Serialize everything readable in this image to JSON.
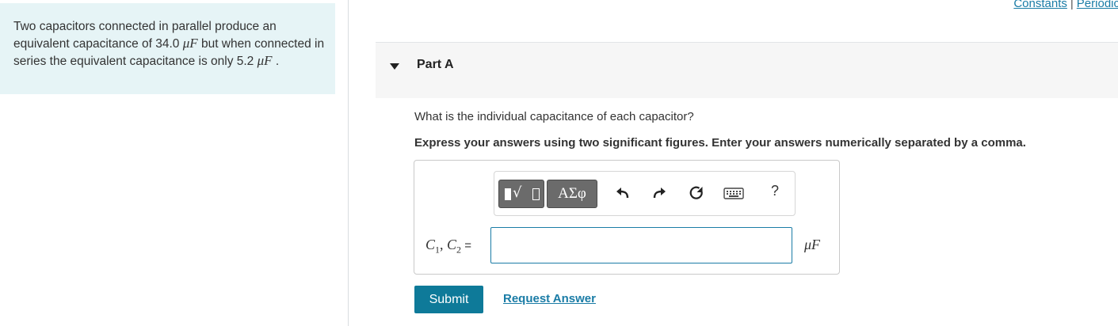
{
  "top_links": {
    "constants": "Constants",
    "separator": "|",
    "periodic": "Periodic"
  },
  "problem": {
    "text_before": "Two capacitors connected in parallel produce an equivalent capacitance of 34.0 ",
    "unit_1": "μF",
    "text_middle": " but when connected in series the equivalent capacitance is only 5.2 ",
    "unit_2": "μF",
    "text_after": " ."
  },
  "part": {
    "title": "Part A"
  },
  "question": "What is the individual capacitance of each capacitor?",
  "instruction": "Express your answers using two significant figures. Enter your answers numerically separated by a comma.",
  "toolbar": {
    "templates_icon": "templates-radical-icon",
    "symbols_label": "ΑΣφ",
    "undo_icon": "undo-icon",
    "redo_icon": "redo-icon",
    "reset_icon": "reset-icon",
    "keyboard_icon": "keyboard-icon",
    "help_label": "?"
  },
  "answer": {
    "label_c1": "C",
    "label_sub1": "1",
    "label_sep": ", ",
    "label_c2": "C",
    "label_sub2": "2",
    "label_eq": " =",
    "value": "",
    "unit": "μF"
  },
  "buttons": {
    "submit": "Submit",
    "request_answer": "Request Answer"
  },
  "colors": {
    "accent": "#0e7a99",
    "link": "#1a7ca6",
    "problem_bg": "#e6f4f6",
    "header_bg": "#f6f6f6"
  }
}
